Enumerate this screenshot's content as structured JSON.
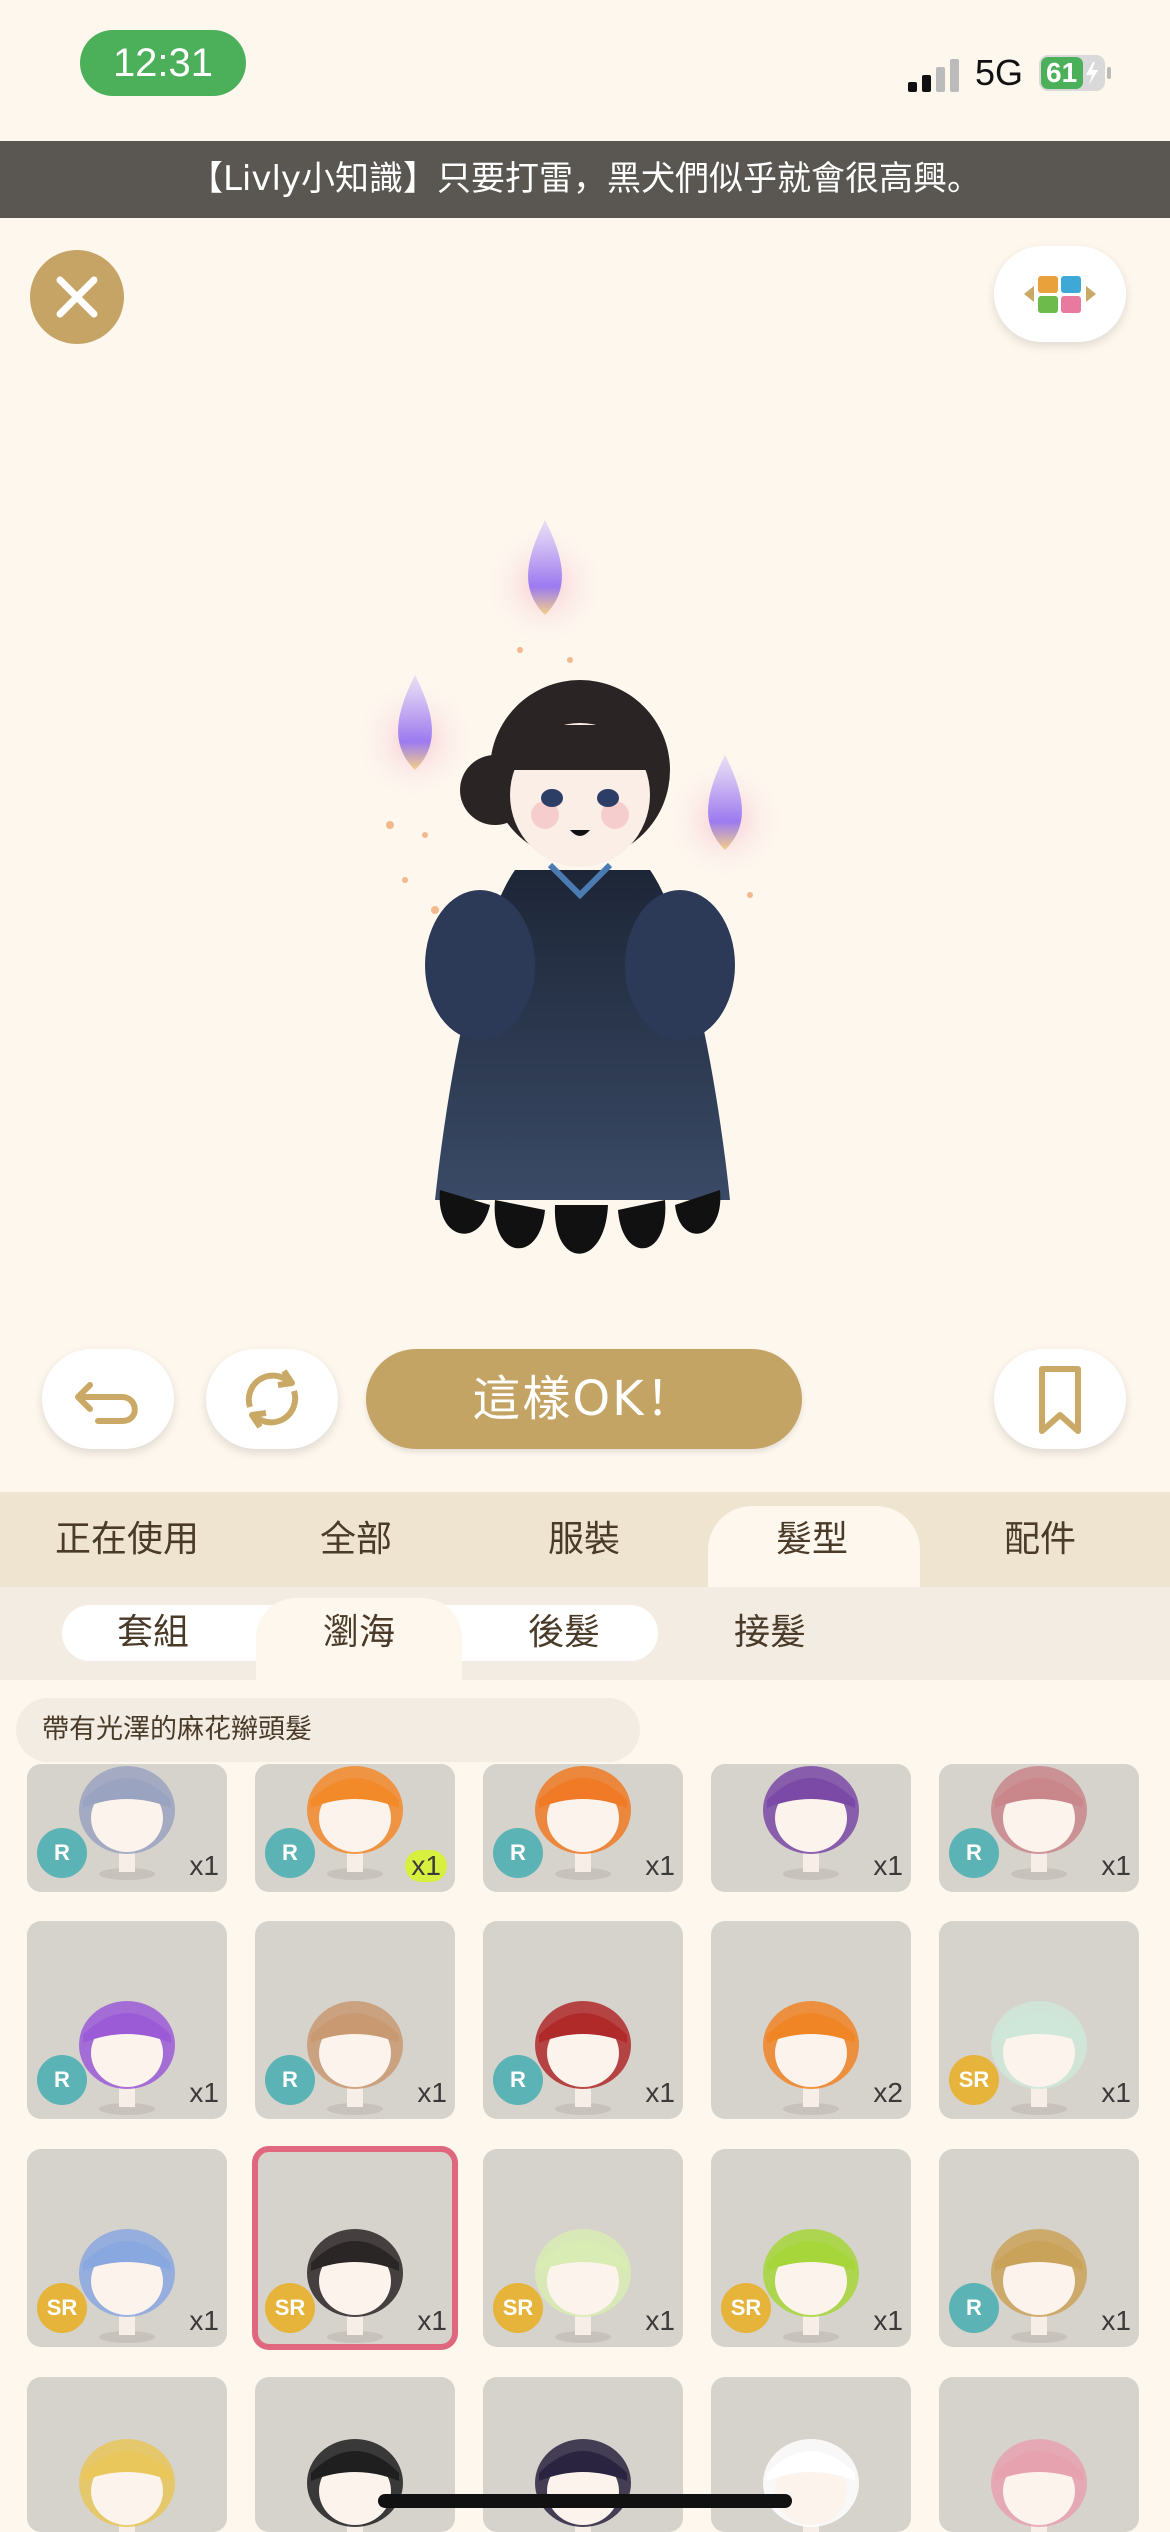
{
  "status_bar": {
    "time": "12:31",
    "network": "5G",
    "battery": "61"
  },
  "tip": "【Livly小知識】只要打雷，黑犬們似乎就會很高興。",
  "actions": {
    "confirm_label": "這樣OK！"
  },
  "categories": [
    "正在使用",
    "全部",
    "服裝",
    "髮型",
    "配件"
  ],
  "active_category": "髮型",
  "subtabs": [
    "套組",
    "瀏海",
    "後髮",
    "接髮"
  ],
  "active_subtab": "瀏海",
  "selected_item_name": "帶有光澤的麻花辮頭髮",
  "colors": {
    "accent_gold": "#c4a465",
    "selected_outline": "#e0687e",
    "rarity_r": "#5cb3b5",
    "rarity_sr": "#e6b43a"
  },
  "items": [
    {
      "rarity": "R",
      "qty": "x1",
      "hair": "#9aa3bf"
    },
    {
      "rarity": "R",
      "qty": "x1",
      "hair": "#f28a2a",
      "highlight": true
    },
    {
      "rarity": "R",
      "qty": "x1",
      "hair": "#f07a25"
    },
    {
      "rarity": "",
      "qty": "x1",
      "hair": "#7a4aa6"
    },
    {
      "rarity": "R",
      "qty": "x1",
      "hair": "#c9878c"
    },
    {
      "rarity": "R",
      "qty": "x1",
      "hair": "#9b5bd6"
    },
    {
      "rarity": "R",
      "qty": "x1",
      "hair": "#c99a72"
    },
    {
      "rarity": "R",
      "qty": "x1",
      "hair": "#b02a2a"
    },
    {
      "rarity": "",
      "qty": "x2",
      "hair": "#f08526"
    },
    {
      "rarity": "SR",
      "qty": "x1",
      "hair": "#cfe7d8"
    },
    {
      "rarity": "SR",
      "qty": "x1",
      "hair": "#8aa8e0"
    },
    {
      "rarity": "SR",
      "qty": "x1",
      "hair": "#2b2626",
      "selected": true
    },
    {
      "rarity": "SR",
      "qty": "x1",
      "hair": "#d9ecb3"
    },
    {
      "rarity": "SR",
      "qty": "x1",
      "hair": "#a6d63a"
    },
    {
      "rarity": "R",
      "qty": "x1",
      "hair": "#caa35a"
    },
    {
      "rarity": "",
      "qty": "",
      "hair": "#e9c75a"
    },
    {
      "rarity": "",
      "qty": "",
      "hair": "#1f1f1f"
    },
    {
      "rarity": "",
      "qty": "",
      "hair": "#2a2440"
    },
    {
      "rarity": "",
      "qty": "",
      "hair": "#ffffff"
    },
    {
      "rarity": "",
      "qty": "",
      "hair": "#e7a2b0"
    }
  ]
}
